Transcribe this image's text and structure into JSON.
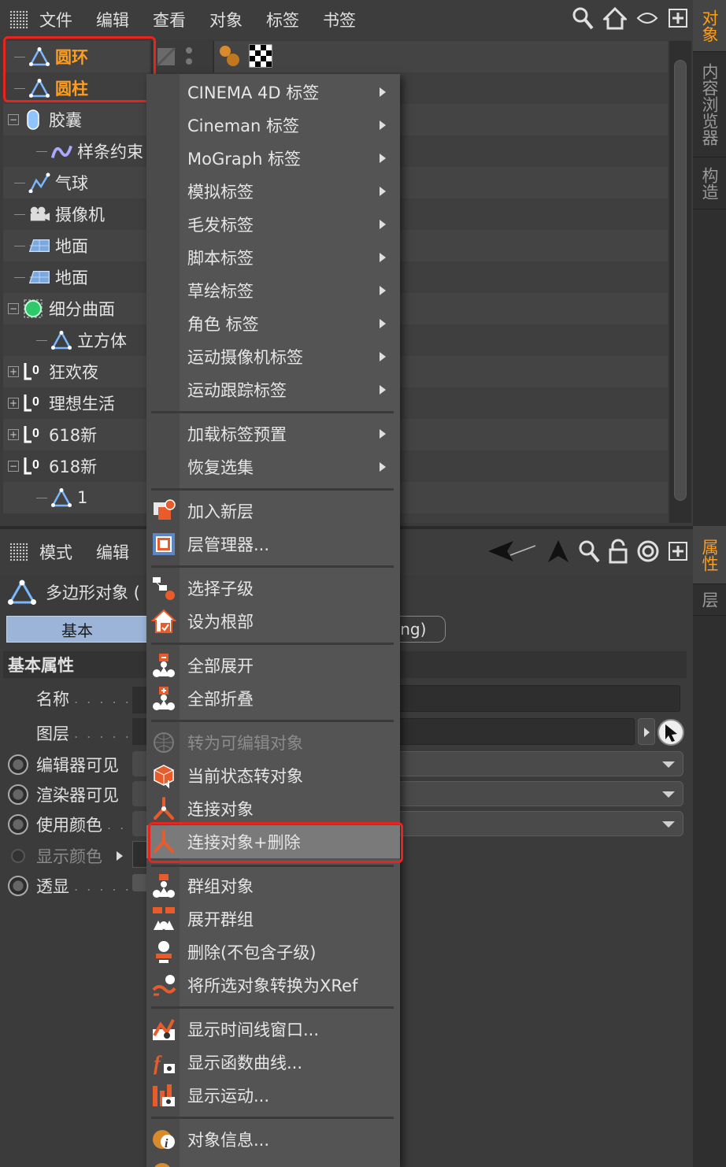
{
  "colors": {
    "accent": "#ff9d1c",
    "highlight_box": "#e8241c",
    "selected_tab": "#9bb4d8"
  },
  "object_manager": {
    "menu": [
      "文件",
      "编辑",
      "查看",
      "对象",
      "标签",
      "书签"
    ],
    "toolbar_icons": [
      "search-icon",
      "home-icon",
      "eye-icon",
      "new-window-icon"
    ],
    "tree": [
      {
        "label": "圆环",
        "icon": "polygon-icon",
        "selected": true
      },
      {
        "label": "圆柱",
        "icon": "polygon-icon",
        "selected": true
      },
      {
        "label": "胶囊",
        "icon": "capsule-icon",
        "expand": "−"
      },
      {
        "label": "样条约束",
        "icon": "spline-constraint-icon",
        "child": true
      },
      {
        "label": "气球",
        "icon": "balloon-icon"
      },
      {
        "label": "摄像机",
        "icon": "camera-icon"
      },
      {
        "label": "地面",
        "icon": "floor-icon"
      },
      {
        "label": "地面",
        "icon": "floor-icon"
      },
      {
        "label": "细分曲面",
        "icon": "subdivision-icon",
        "expand": "−"
      },
      {
        "label": "立方体",
        "icon": "polygon-icon",
        "child": true
      },
      {
        "label": "狂欢夜",
        "icon": "null-icon",
        "expand": "+"
      },
      {
        "label": "理想生活",
        "icon": "null-icon",
        "expand": "+"
      },
      {
        "label": "618新",
        "icon": "null-icon",
        "expand": "+"
      },
      {
        "label": "618新",
        "icon": "null-icon",
        "expand": "−"
      },
      {
        "label": "1",
        "icon": "polygon-icon",
        "child": true
      }
    ]
  },
  "side_tabs_top": [
    "对象",
    "内容浏览器",
    "构造"
  ],
  "side_tabs_bottom": [
    "属性",
    "层"
  ],
  "attribute_manager": {
    "menu": [
      "模式",
      "编辑"
    ],
    "title": "多边形对象 (",
    "tab_basic": "基本",
    "tab_phong": "ong)",
    "section": "基本属性",
    "props": [
      {
        "label": "名称",
        "dots": ". . . . ."
      },
      {
        "label": "图层",
        "dots": ". . . . ."
      },
      {
        "label": "编辑器可见",
        "radio": true
      },
      {
        "label": "渲染器可见",
        "radio": true
      },
      {
        "label": "使用颜色",
        "radio": true,
        "dots": ". ."
      },
      {
        "label": "显示颜色",
        "radio_dim": true
      },
      {
        "label": "透显",
        "radio": true,
        "dots": ". . . . ."
      }
    ]
  },
  "context_menu": {
    "group1": [
      "CINEMA 4D 标签",
      "Cineman 标签",
      "MoGraph 标签",
      "模拟标签",
      "毛发标签",
      "脚本标签",
      "草绘标签",
      "角色 标签",
      "运动摄像机标签",
      "运动跟踪标签"
    ],
    "group2": [
      "加载标签预置",
      "恢复选集"
    ],
    "group3": [
      {
        "label": "加入新层",
        "icon": "add-layer-icon"
      },
      {
        "label": "层管理器...",
        "icon": "layer-manager-icon"
      }
    ],
    "group4": [
      {
        "label": "选择子级",
        "icon": "select-children-icon"
      },
      {
        "label": "设为根部",
        "icon": "set-root-icon"
      }
    ],
    "group5": [
      {
        "label": "全部展开",
        "icon": "expand-all-icon"
      },
      {
        "label": "全部折叠",
        "icon": "collapse-all-icon"
      }
    ],
    "group6": [
      {
        "label": "转为可编辑对象",
        "icon": "make-editable-icon",
        "disabled": true
      },
      {
        "label": "当前状态转对象",
        "icon": "current-state-icon"
      },
      {
        "label": "连接对象",
        "icon": "connect-icon"
      },
      {
        "label": "连接对象+删除",
        "icon": "connect-delete-icon",
        "highlighted": true
      }
    ],
    "group7": [
      {
        "label": "群组对象",
        "icon": "group-icon"
      },
      {
        "label": "展开群组",
        "icon": "ungroup-icon"
      },
      {
        "label": "删除(不包含子级)",
        "icon": "delete-no-children-icon"
      },
      {
        "label": "将所选对象转换为XRef",
        "icon": "xref-icon"
      }
    ],
    "group8": [
      {
        "label": "显示时间线窗口...",
        "icon": "timeline-icon"
      },
      {
        "label": "显示函数曲线...",
        "icon": "fcurve-icon"
      },
      {
        "label": "显示运动...",
        "icon": "motion-icon"
      }
    ],
    "group9": [
      {
        "label": "对象信息...",
        "icon": "object-info-icon"
      }
    ]
  }
}
